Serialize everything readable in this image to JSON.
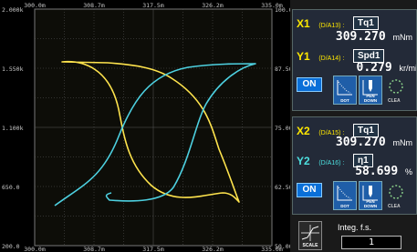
{
  "plot": {
    "top_ticks": [
      "300.0m",
      "308.7m",
      "317.5m",
      "326.2m",
      "335.0m"
    ],
    "bottom_ticks": [
      "300.0m",
      "308.7m",
      "317.5m",
      "326.2m",
      "335.0m"
    ],
    "left_ticks": [
      "2.000k",
      "1.550k",
      "1.100k",
      "650.0",
      "200.0"
    ],
    "right_ticks": [
      "100.0",
      "87.50",
      "75.00",
      "62.50",
      "50.00"
    ],
    "colors": {
      "trace1": "#ffe44d",
      "trace2": "#4dd0e0",
      "grid": "#5a5a5a",
      "background": "#000000"
    }
  },
  "channel1": {
    "x_label": "X1",
    "x_src": "(D/A13) :",
    "x_select": "Tq1",
    "x_value": "309.270",
    "x_unit": "mNm",
    "y_label": "Y1",
    "y_src": "(D/A14) :",
    "y_select": "Spd1",
    "y_value": "0.279",
    "y_unit": "kr/min",
    "on_label": "ON",
    "dot_label": "DOT",
    "pen_label": "PEN DOWN",
    "clear_label": "CLEA"
  },
  "channel2": {
    "x_label": "X2",
    "x_src": "(D/A15) :",
    "x_select": "Tq1",
    "x_value": "309.270",
    "x_unit": "mNm",
    "y_label": "Y2",
    "y_src": "(D/A16) :",
    "y_select": "η1",
    "y_value": "58.699",
    "y_unit": "%",
    "on_label": "ON",
    "dot_label": "DOT",
    "pen_label": "PEN DOWN",
    "clear_label": "CLEA"
  },
  "footer": {
    "scale_label": "SCALE",
    "integ_label": "Integ. f.s.",
    "integ_value": "1"
  }
}
